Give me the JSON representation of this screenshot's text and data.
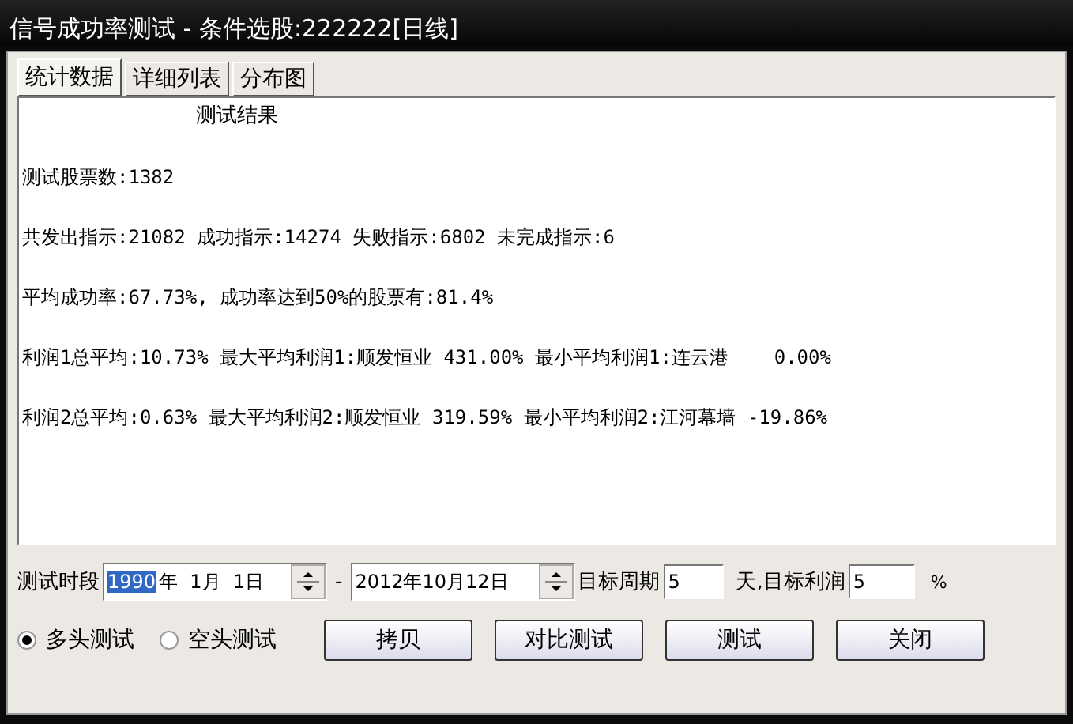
{
  "window": {
    "title": "信号成功率测试 - 条件选股:222222[日线]"
  },
  "tabs": [
    {
      "label": "统计数据",
      "selected": true
    },
    {
      "label": "详细列表",
      "selected": false
    },
    {
      "label": "分布图",
      "selected": false
    }
  ],
  "results": {
    "heading": "测试结果",
    "lines": [
      "测试股票数:1382",
      "共发出指示:21082 成功指示:14274 失败指示:6802 未完成指示:6",
      "平均成功率:67.73%, 成功率达到50%的股票有:81.4%",
      "利润1总平均:10.73% 最大平均利润1:顺发恒业 431.00% 最小平均利润1:连云港    0.00%",
      "利润2总平均:0.63% 最大平均利润2:顺发恒业 319.59% 最小平均利润2:江河幕墙 -19.86%"
    ]
  },
  "period": {
    "label": "测试时段",
    "separator": "-",
    "date_from": [
      {
        "text": "1990",
        "selected": true
      },
      {
        "text": "年  1月  1日",
        "selected": false
      }
    ],
    "date_to": [
      {
        "text": "2012年10月12日",
        "selected": false
      }
    ],
    "target_period_label": "目标周期",
    "target_period": "5",
    "target_profit_label": "天,目标利润",
    "target_profit": "5",
    "percent": "%"
  },
  "modes": [
    {
      "label": "多头测试",
      "selected": true
    },
    {
      "label": "空头测试",
      "selected": false
    }
  ],
  "buttons": [
    "拷贝",
    "对比测试",
    "测试",
    "关闭"
  ]
}
